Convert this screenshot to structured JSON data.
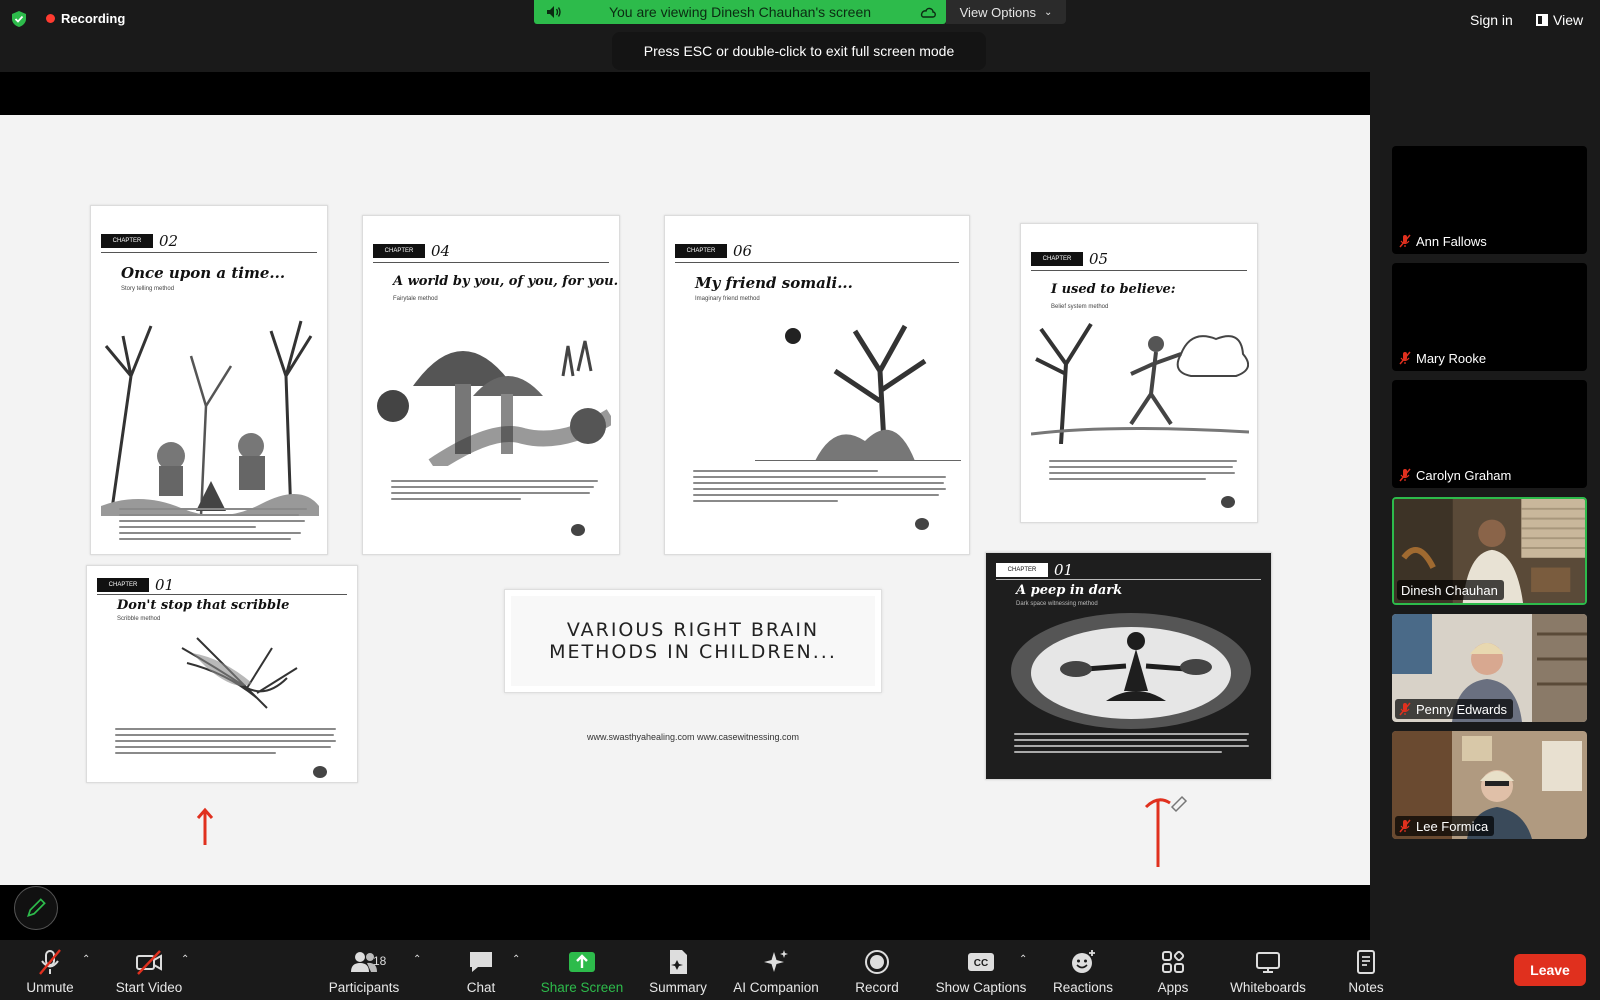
{
  "topbar": {
    "recording_label": "Recording",
    "share_banner": "You are viewing Dinesh Chauhan's screen",
    "view_options": "View Options",
    "esc_tip": "Press ESC or double-click to exit full screen mode",
    "sign_in": "Sign in",
    "view": "View"
  },
  "slide": {
    "pages": [
      {
        "chapter_tag": "CHAPTER",
        "chapter_num": "02",
        "title": "Once upon a time...",
        "subtitle": "Story telling method"
      },
      {
        "chapter_tag": "CHAPTER",
        "chapter_num": "04",
        "title": "A world by you, of you, for you...",
        "subtitle": "Fairytale method"
      },
      {
        "chapter_tag": "CHAPTER",
        "chapter_num": "06",
        "title": "My friend somali...",
        "subtitle": "Imaginary friend method"
      },
      {
        "chapter_tag": "CHAPTER",
        "chapter_num": "05",
        "title": "I used to believe:",
        "subtitle": "Belief system method"
      },
      {
        "chapter_tag": "CHAPTER",
        "chapter_num": "01",
        "title": "Don't stop that scribble",
        "subtitle": "Scribble method"
      },
      {
        "chapter_tag": "CHAPTER",
        "chapter_num": "01",
        "title": "A peep in dark",
        "subtitle": "Dark space witnessing method"
      }
    ],
    "center_line1": "VARIOUS RIGHT BRAIN",
    "center_line2": "METHODS IN CHILDREN...",
    "urls": "www.swasthyahealing.com www.casewitnessing.com"
  },
  "participants": [
    {
      "name": "Ann Fallows",
      "muted": true,
      "video": false
    },
    {
      "name": "Mary Rooke",
      "muted": true,
      "video": false
    },
    {
      "name": "Carolyn Graham",
      "muted": true,
      "video": false
    },
    {
      "name": "Dinesh Chauhan",
      "muted": false,
      "video": true,
      "active_speaker": true
    },
    {
      "name": "Penny Edwards",
      "muted": true,
      "video": true
    },
    {
      "name": "Lee Formica",
      "muted": true,
      "video": true
    }
  ],
  "toolbar": {
    "unmute": "Unmute",
    "start_video": "Start Video",
    "participants": "Participants",
    "participant_count": "18",
    "chat": "Chat",
    "share_screen": "Share Screen",
    "summary": "Summary",
    "ai_companion": "AI Companion",
    "record": "Record",
    "show_captions": "Show Captions",
    "captions_badge": "CC",
    "reactions": "Reactions",
    "apps": "Apps",
    "whiteboards": "Whiteboards",
    "notes": "Notes",
    "leave": "Leave"
  },
  "colors": {
    "accent_green": "#2dbb4b",
    "leave_red": "#e0301e",
    "mute_red": "#e0301e"
  }
}
